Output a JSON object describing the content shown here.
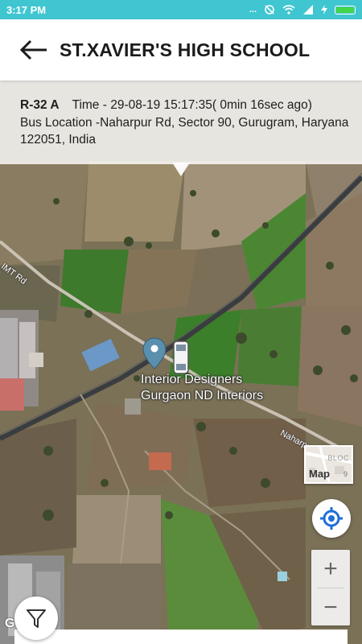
{
  "status_bar": {
    "time": "3:17 PM",
    "icons": [
      "dots-icon",
      "sync-off-icon",
      "wifi-icon",
      "signal-icon",
      "charging-icon",
      "battery-icon"
    ],
    "dots": "..."
  },
  "header": {
    "title": "ST.XAVIER'S HIGH SCHOOL"
  },
  "info": {
    "route": "R-32 A",
    "time": "Time -  29-08-19 15:17:35( 0min 16sec ago)",
    "location": "Bus Location -Naharpur Rd, Sector 90, Gurugram, Haryana 122051, India"
  },
  "map": {
    "roads": {
      "imt": "IMT Rd",
      "naharpur": "Naharpur D"
    },
    "poi": {
      "line1": "Interior Designers",
      "line2": "Gurgaon ND Interiors"
    },
    "thumbnail": {
      "label": "Map",
      "bloc": "BLOC",
      "num": "9"
    },
    "zoom": {
      "in": "+",
      "out": "−"
    },
    "attribution": "G"
  },
  "colors": {
    "status_bar": "#3fc6d0",
    "accent": "#1e6fd9",
    "marker": "#5b8fae"
  }
}
